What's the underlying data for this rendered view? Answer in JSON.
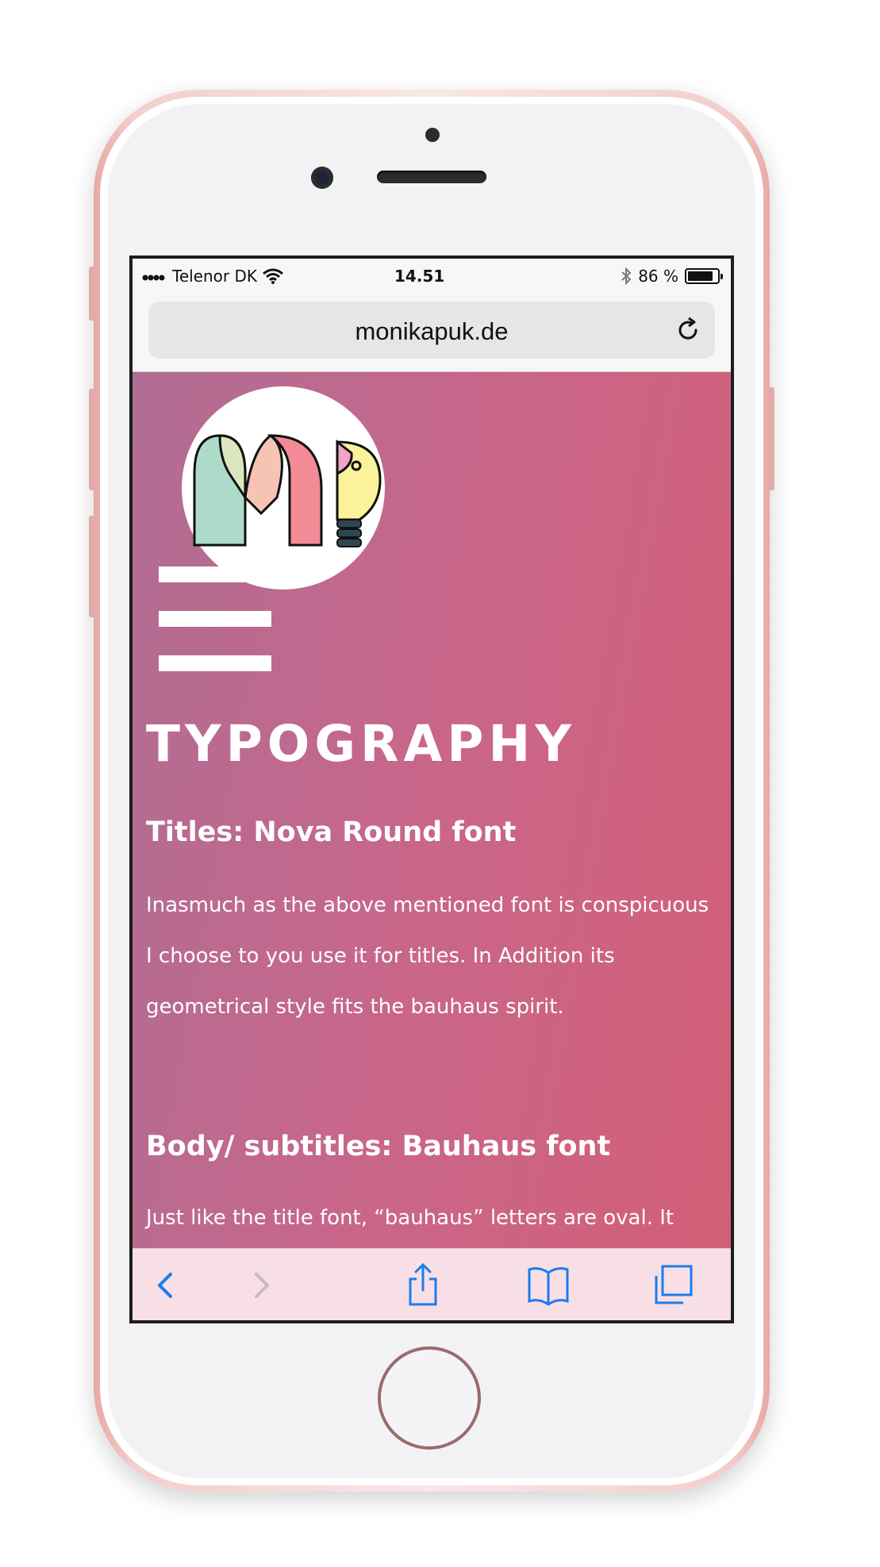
{
  "status_bar": {
    "carrier": "Telenor DK",
    "time": "14.51",
    "battery_text": "86 %",
    "battery_level": 0.86
  },
  "browser": {
    "url": "monikapuk.de"
  },
  "page": {
    "logo_icon": "mp-lightbulb-logo",
    "menu_icon": "hamburger-menu-icon",
    "title": "TYPOGRAPHY",
    "section1_heading": "Titles: Nova Round font",
    "section1_text": "Inasmuch as the above mentioned font is conspicuous I choose to you use it for titles. In Addition its geometrical style fits the bauhaus spirit.",
    "section2_heading": "Body/ subtitles: Bauhaus font",
    "section2_text": "Just like the title font, “bauhaus” letters are oval. It"
  },
  "toolbar": {
    "back_icon": "chevron-left-icon",
    "forward_icon": "chevron-right-icon",
    "share_icon": "share-icon",
    "bookmarks_icon": "book-icon",
    "tabs_icon": "tabs-icon"
  },
  "colors": {
    "gradient_start": "#b06d93",
    "gradient_end": "#d35f77",
    "toolbar_tint": "#1a7cf0",
    "phone_rose_gold": "#e7a9a6"
  }
}
